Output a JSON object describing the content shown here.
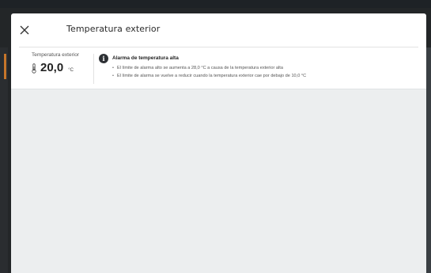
{
  "modal": {
    "title": "Temperatura exterior",
    "close_icon": "close-icon"
  },
  "temperature": {
    "label": "Temperatura exterior",
    "value": "20,0",
    "unit": "°C",
    "icon": "thermometer-icon"
  },
  "alarm": {
    "icon": "info-icon",
    "icon_glyph": "i",
    "title": "Alarma de temperatura alta",
    "items": [
      "El límite de alarma alto se aumenta a 28,0 °C a causa de la temperatura exterior alta",
      "El límite de alarma se vuelve a reducir cuando la temperatura exterior cae por debajo de 10,0 °C"
    ]
  },
  "colors": {
    "backdrop": "#232628",
    "modal_bg": "#ffffff",
    "content_bg": "#eceeef",
    "accent": "#c7762a"
  }
}
